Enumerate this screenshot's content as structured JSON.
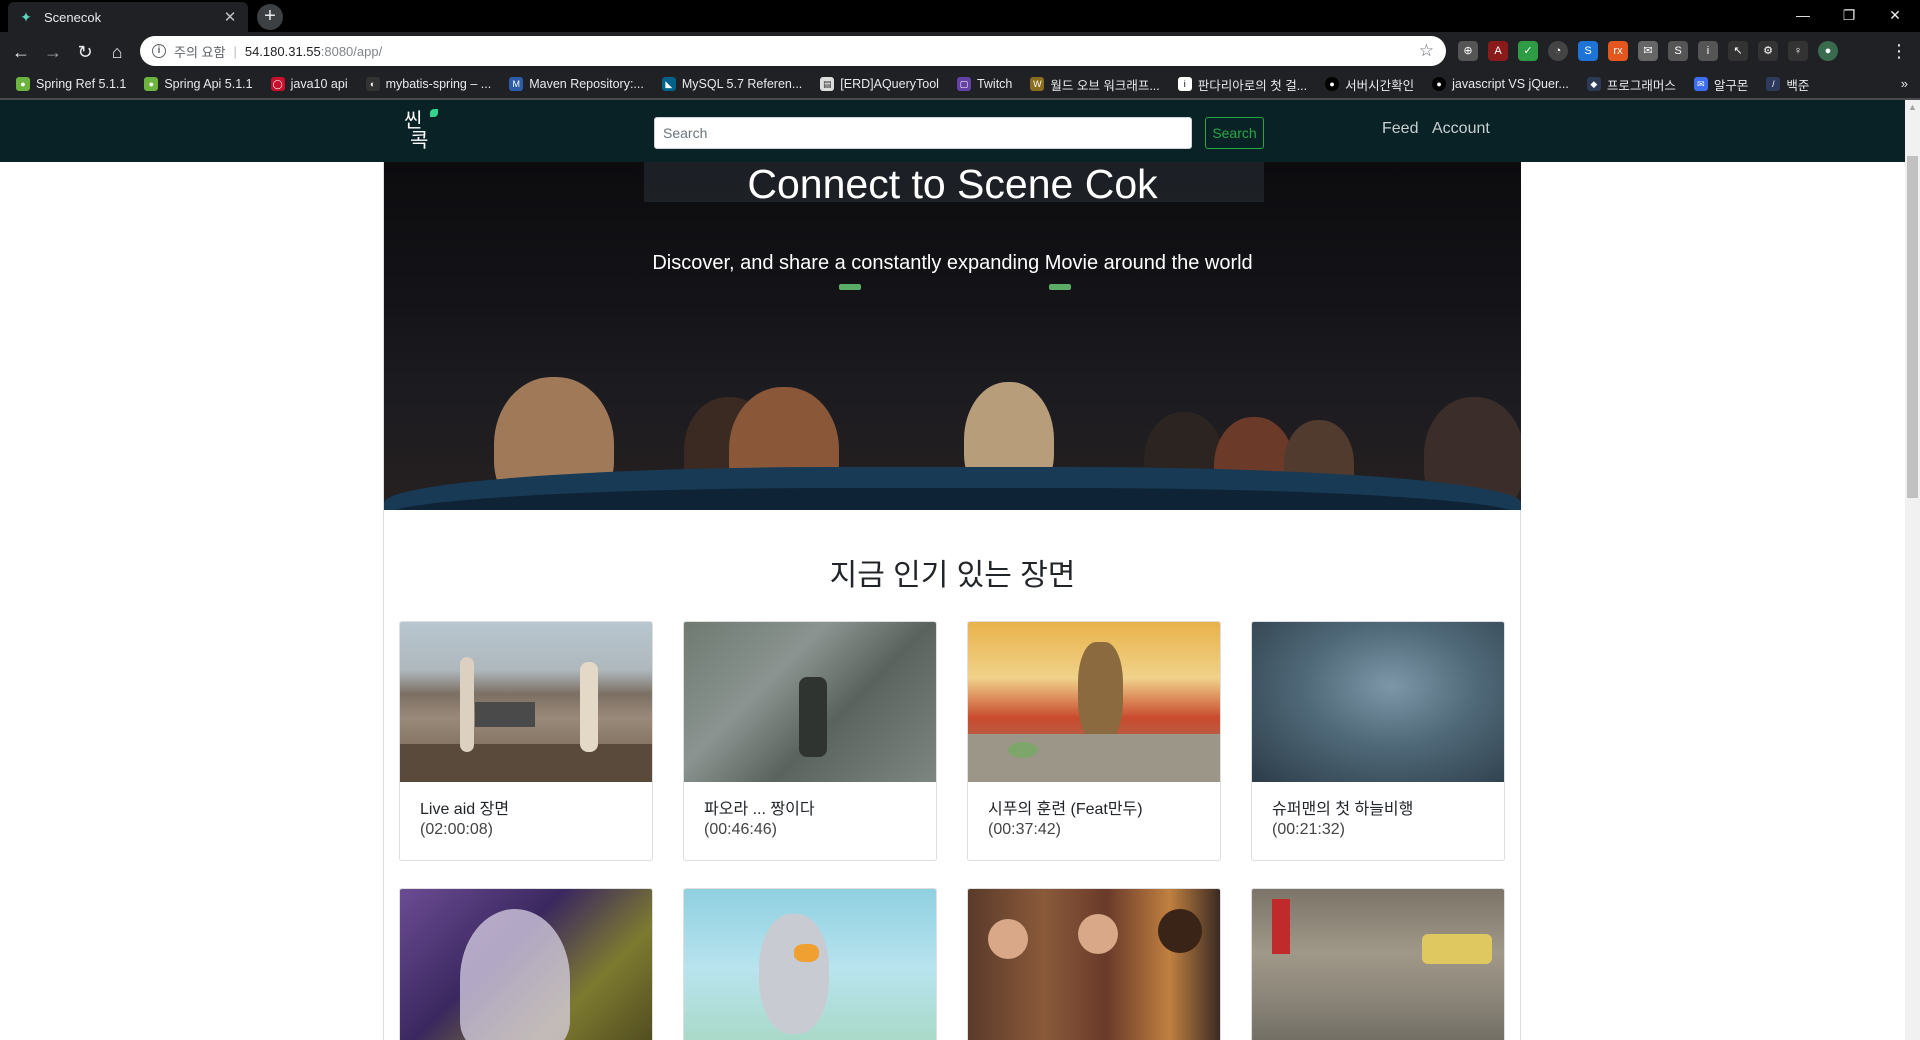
{
  "browser": {
    "tab_title": "Scenecok",
    "url_warning": "주의 요함",
    "url_host": "54.180.31.55",
    "url_path": ":8080/app/",
    "bookmarks": [
      "Spring Ref 5.1.1",
      "Spring Api 5.1.1",
      "java10 api",
      "mybatis-spring – ...",
      "Maven Repository:...",
      "MySQL 5.7 Referen...",
      "[ERD]AQueryTool",
      "Twitch",
      "월드 오브 워크래프...",
      "판다리아로의 첫 걸...",
      "서버시간확인",
      "javascript VS jQuer...",
      "프로그래머스",
      "알구몬",
      "백준"
    ],
    "bookmarks_more": "»"
  },
  "navbar": {
    "logo_line1": "씬",
    "logo_line2": "콕",
    "search_placeholder": "Search",
    "search_button": "Search",
    "links": [
      "Feed",
      "Account"
    ]
  },
  "hero": {
    "title": "Connect to Scene Cok",
    "subtitle": "Discover, and share a constantly expanding Movie around the world"
  },
  "popular": {
    "title": "지금 인기 있는 장면",
    "cards": [
      {
        "title": "Live aid 장면",
        "time": "(02:00:08)"
      },
      {
        "title": "파오라 ... 짱이다",
        "time": "(00:46:46)"
      },
      {
        "title": "시푸의 훈련 (Feat만두)",
        "time": "(00:37:42)"
      },
      {
        "title": "슈퍼맨의 첫 하늘비행",
        "time": "(00:21:32)"
      },
      {
        "title": "",
        "time": ""
      },
      {
        "title": "",
        "time": ""
      },
      {
        "title": "",
        "time": ""
      },
      {
        "title": "",
        "time": ""
      }
    ]
  },
  "colors": {
    "navbar_bg": "#082226",
    "search_accent": "#28a745"
  }
}
